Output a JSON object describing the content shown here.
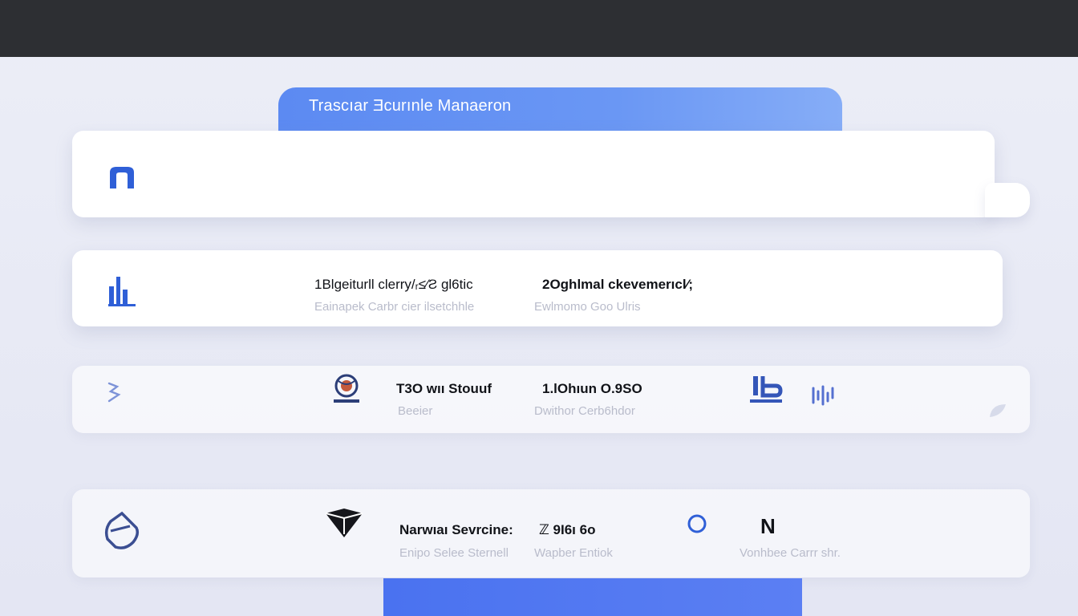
{
  "banner": {
    "title": "Trascıar  Ǝcurınle  Manaeron"
  },
  "rows": [
    {
      "icon": "drawer-icon"
    },
    {
      "icon": "chart-icon",
      "col1": {
        "primary": "1Blgeiturll  clerry/ᵣ≤⁄Ƨ gl6tic",
        "secondary": "Eainapek  Carbr cier  ilsetchhle"
      },
      "col2": {
        "primary": "2Oghlmal  ckevemerıcl⁄;",
        "secondary": "Ewlmomo  Goo  Ulris"
      }
    },
    {
      "icon": "pencil-icon",
      "badge_icon": "globe-badge-icon",
      "col1": {
        "primary": "T3O wıı  Stouuf",
        "secondary": "Beeier"
      },
      "col2": {
        "primary": "1.lOhıun  O.9SO",
        "secondary": "Dwithor  Cerb6hdor"
      },
      "extra_icons": [
        "lab-icon",
        "sparkle-icon",
        "leaf-icon"
      ]
    },
    {
      "icon": "tag-icon",
      "badge_icon": "gem-icon",
      "col1": {
        "primary": "Narwıaı  Sevrcine:",
        "secondary": "Enipo  Selee  Sternell"
      },
      "col2": {
        "primary": "ℤ  9I6ı  6o",
        "secondary": "Wapber  Entiok"
      },
      "status_icon": "circle-indicator-icon",
      "logo_text": "N",
      "col3": {
        "secondary": "Vonhbee  Carrr shr."
      }
    }
  ],
  "colors": {
    "accent": "#2f5fd7",
    "banner": "#6a97f4",
    "topbar": "#2d2f33",
    "bottom_bar": "#4a72f0"
  }
}
